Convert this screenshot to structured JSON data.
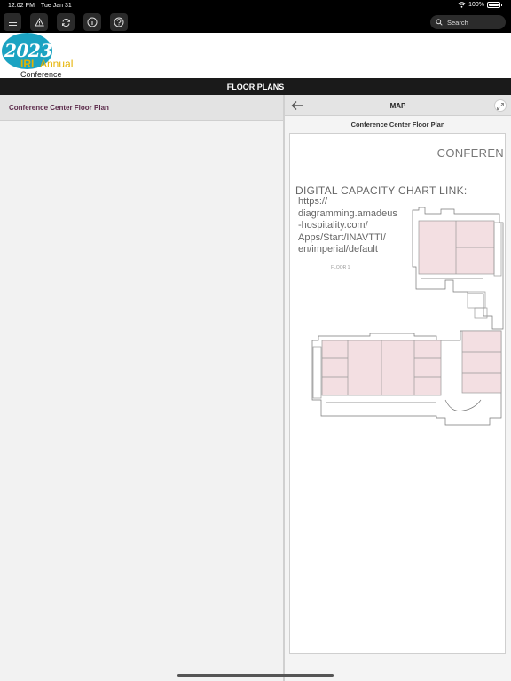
{
  "status": {
    "time": "12:02 PM",
    "date": "Tue Jan 31",
    "battery": "100%"
  },
  "toolbar": {
    "icons": [
      "menu-icon",
      "alert-icon",
      "sync-icon",
      "info-icon",
      "help-icon"
    ],
    "search_label": "Search"
  },
  "brand": {
    "year": "2023",
    "iri": "IRI",
    "annual": "Annual",
    "conference": "Conference",
    "accent": "#1ba3c2",
    "gold": "#e5b200"
  },
  "title": "FLOOR PLANS",
  "list": {
    "items": [
      {
        "label": "Conference Center Floor Plan"
      }
    ]
  },
  "map": {
    "header": "MAP",
    "subtitle": "Conference Center Floor Plan",
    "document": {
      "heading": "CONFEREN",
      "link_title": "DIGITAL CAPACITY CHART LINK:",
      "url_lines": [
        "https://",
        "diagramming.amadeus",
        "-hospitality.com/",
        "Apps/Start/INAVTTI/",
        "en/imperial/default"
      ],
      "floor_label": "FLOOR 1"
    }
  }
}
